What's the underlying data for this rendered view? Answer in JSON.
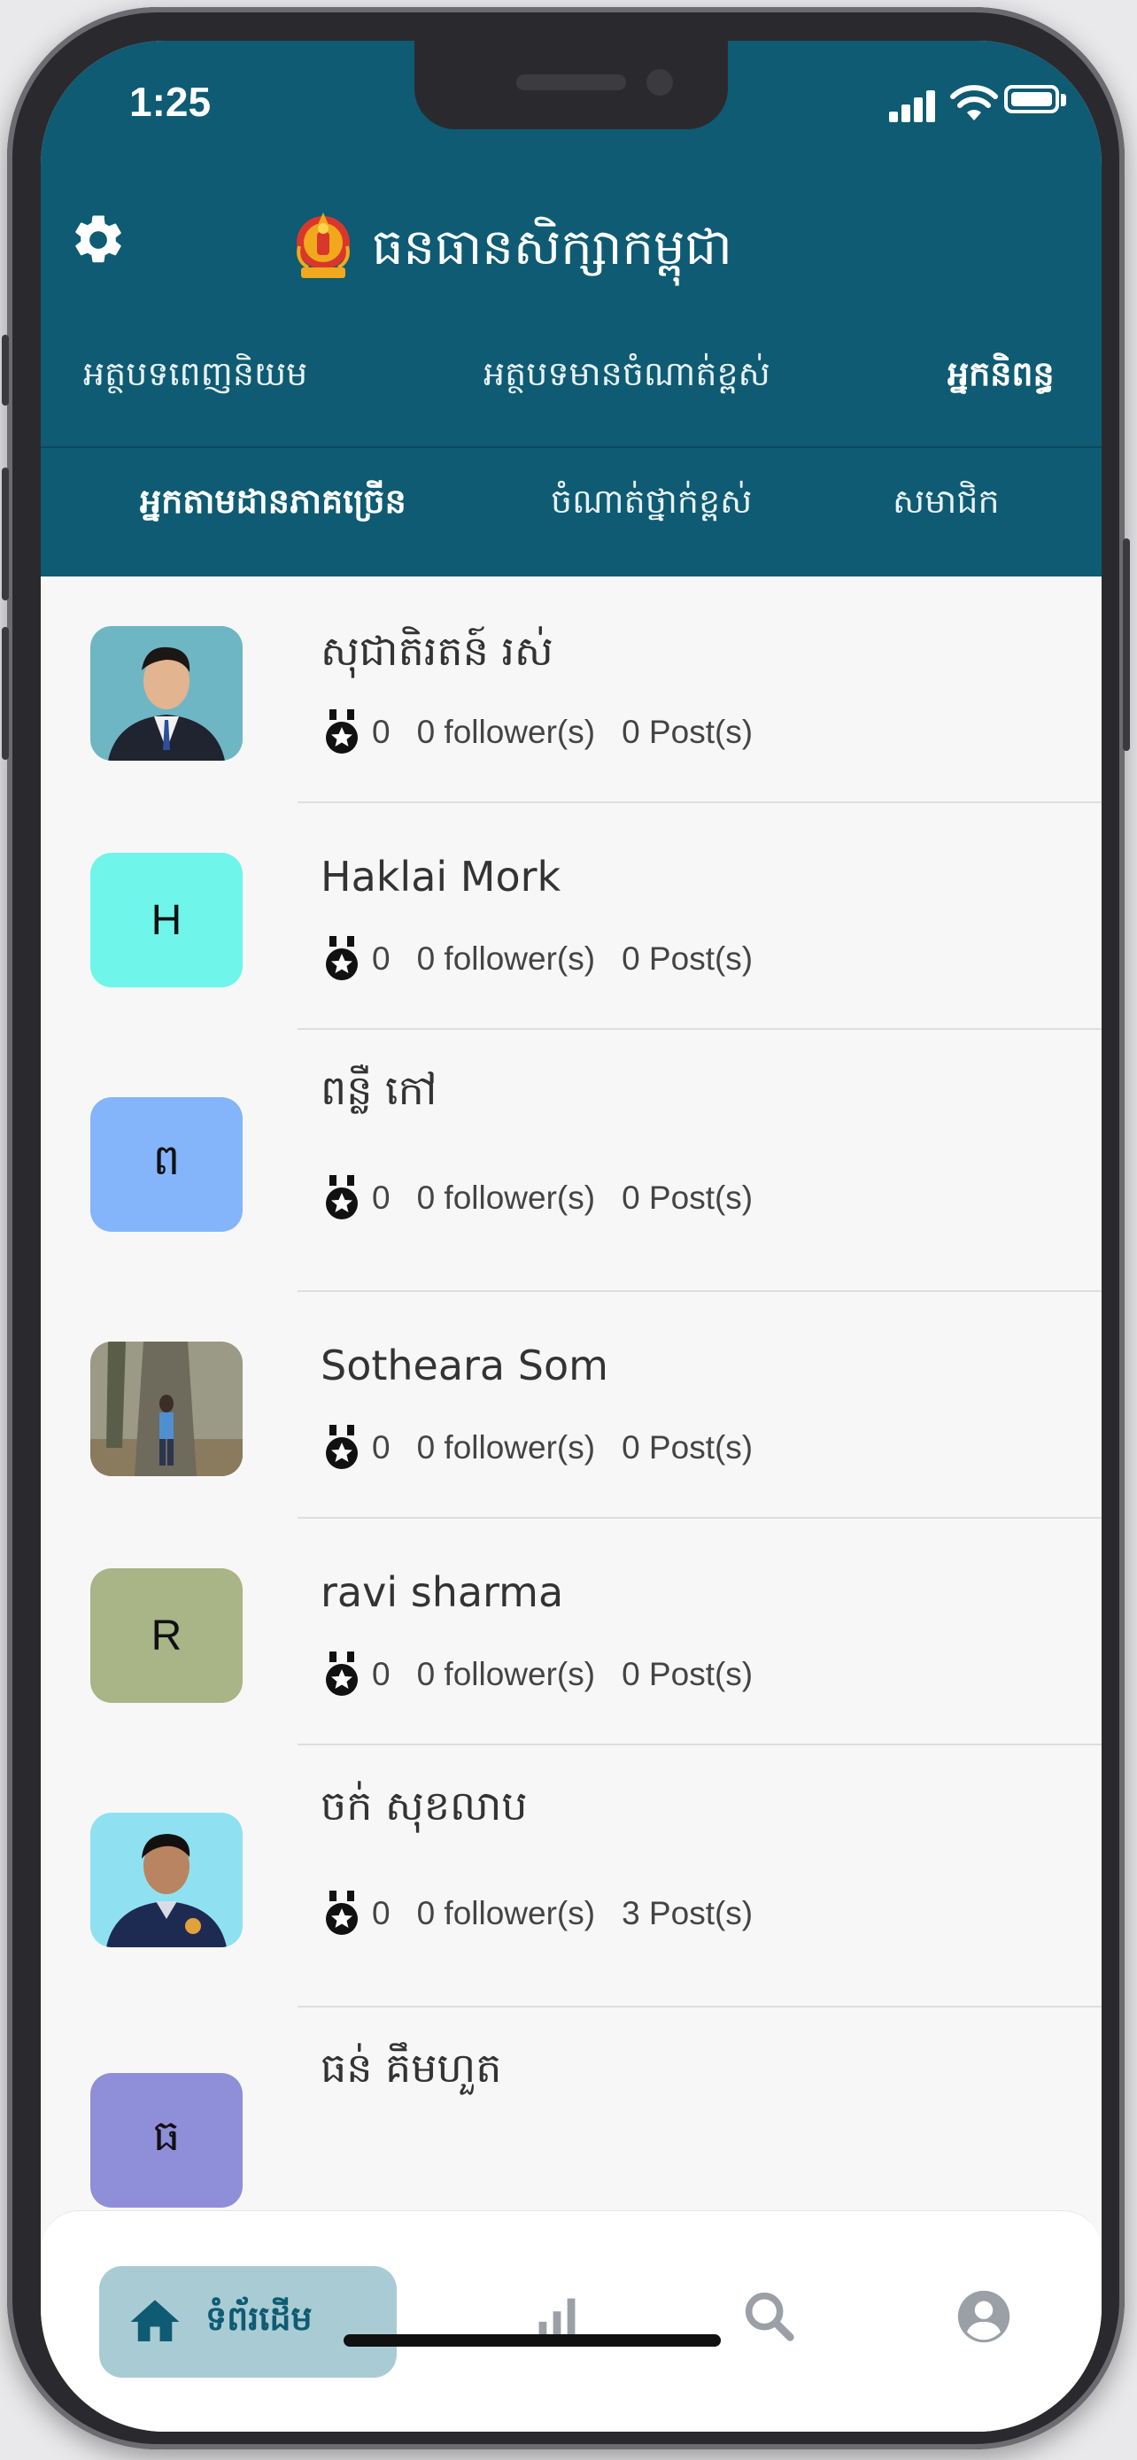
{
  "status_bar": {
    "time": "1:25"
  },
  "header": {
    "title": "ធនធានសិក្សាកម្ពុជា",
    "tabs_primary": [
      "អត្ថបទពេញនិយម",
      "អត្ថបទមានចំណាត់ខ្ពស់",
      "អ្នកនិពន្ធ"
    ],
    "tabs_secondary": [
      "អ្នកតាមដានភាគច្រើន",
      "ចំណាត់ថ្នាក់ខ្ពស់",
      "សមាជិក"
    ]
  },
  "authors": [
    {
      "name": "សុជាតិរតន៍ រស់",
      "initial": "",
      "avatar_color": "#6fb6c5",
      "medals": "0",
      "followers": "0 follower(s)",
      "posts": "0 Post(s)"
    },
    {
      "name": "Haklai Mork",
      "initial": "H",
      "avatar_color": "#6ff5ea",
      "medals": "0",
      "followers": "0 follower(s)",
      "posts": "0 Post(s)"
    },
    {
      "name": "ពន្លឺ កៅ",
      "initial": "ព",
      "avatar_color": "#84b5fa",
      "medals": "0",
      "followers": "0 follower(s)",
      "posts": "0 Post(s)"
    },
    {
      "name": "Sotheara Som",
      "initial": "",
      "avatar_color": "#8a8a78",
      "medals": "0",
      "followers": "0 follower(s)",
      "posts": "0 Post(s)"
    },
    {
      "name": "ravi sharma",
      "initial": "R",
      "avatar_color": "#a9b487",
      "medals": "0",
      "followers": "0 follower(s)",
      "posts": "0 Post(s)"
    },
    {
      "name": "ចក់ សុខលាប",
      "initial": "",
      "avatar_color": "#8fe1f2",
      "medals": "0",
      "followers": "0 follower(s)",
      "posts": "3 Post(s)"
    },
    {
      "name": "ធន់ គឹមហួត",
      "initial": "ធ",
      "avatar_color": "#8f8ed8",
      "medals": "",
      "followers": "",
      "posts": ""
    }
  ],
  "bottom_nav": {
    "home_label": "ទំព័រដើម",
    "icons": [
      "home-icon",
      "bar-chart-icon",
      "search-icon",
      "account-icon"
    ]
  },
  "colors": {
    "primary": "#0e5b73",
    "home_pill": "#a9ccd4"
  }
}
